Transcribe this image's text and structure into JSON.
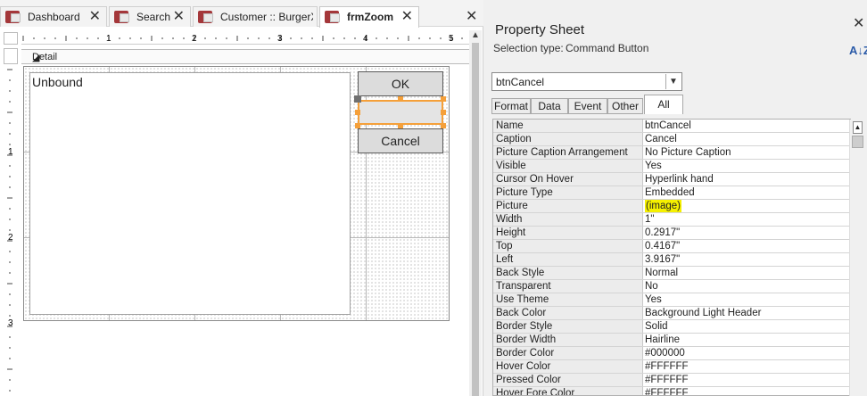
{
  "document": {
    "tabs": [
      {
        "label": "Dashboard",
        "active": false
      },
      {
        "label": "Search",
        "active": false
      },
      {
        "label": "Customer :: BurgerX...",
        "active": false
      },
      {
        "label": "frmZoom",
        "active": true
      }
    ],
    "ruler_top_numbers": [
      "1",
      "2",
      "3",
      "4",
      "5"
    ],
    "ruler_left_numbers": [
      "1",
      "2",
      "3"
    ],
    "section_label": "Detail",
    "unbound_text": "Unbound",
    "buttons": {
      "ok": "OK",
      "selected": "",
      "cancel": "Cancel"
    },
    "close_glyph": "✕"
  },
  "property_sheet": {
    "title": "Property Sheet",
    "selection_type_label": "Selection type:",
    "selection_type_value": "Command Button",
    "sort_icon": "A↓Z",
    "combo_value": "btnCancel",
    "tabs": [
      "Format",
      "Data",
      "Event",
      "Other",
      "All"
    ],
    "active_tab": "All",
    "highlight_color": "#f5f000",
    "rows": [
      {
        "name": "Name",
        "value": "btnCancel"
      },
      {
        "name": "Caption",
        "value": "Cancel"
      },
      {
        "name": "Picture Caption Arrangement",
        "value": "No Picture Caption"
      },
      {
        "name": "Visible",
        "value": "Yes"
      },
      {
        "name": "Cursor On Hover",
        "value": "Hyperlink hand"
      },
      {
        "name": "Picture Type",
        "value": "Embedded"
      },
      {
        "name": "Picture",
        "value": "(image)"
      },
      {
        "name": "Width",
        "value": "1\""
      },
      {
        "name": "Height",
        "value": "0.2917\""
      },
      {
        "name": "Top",
        "value": "0.4167\""
      },
      {
        "name": "Left",
        "value": "3.9167\""
      },
      {
        "name": "Back Style",
        "value": "Normal"
      },
      {
        "name": "Transparent",
        "value": "No"
      },
      {
        "name": "Use Theme",
        "value": "Yes"
      },
      {
        "name": "Back Color",
        "value": "Background Light Header"
      },
      {
        "name": "Border Style",
        "value": "Solid"
      },
      {
        "name": "Border Width",
        "value": "Hairline"
      },
      {
        "name": "Border Color",
        "value": "#000000"
      },
      {
        "name": "Hover Color",
        "value": "#FFFFFF"
      },
      {
        "name": "Pressed Color",
        "value": "#FFFFFF"
      },
      {
        "name": "Hover Fore Color",
        "value": "#FFFFFF"
      }
    ]
  }
}
